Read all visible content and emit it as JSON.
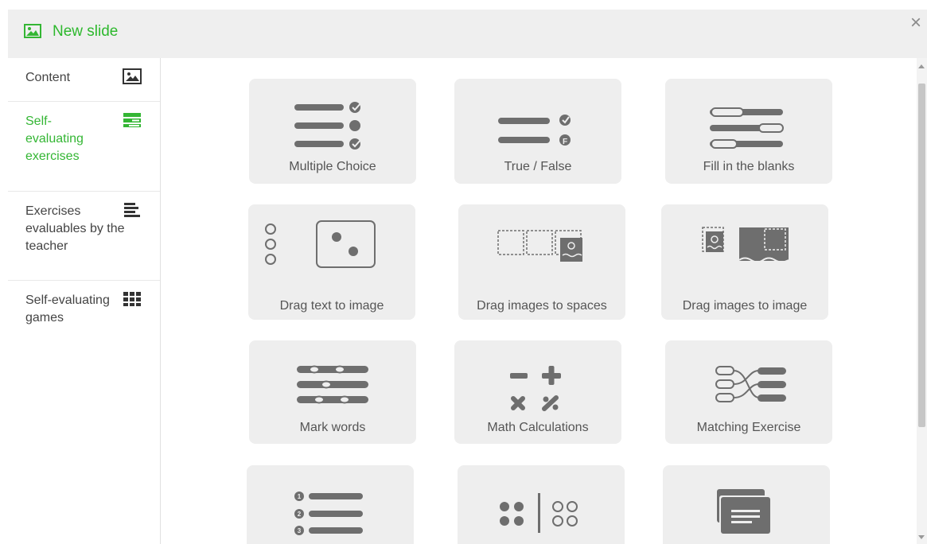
{
  "header": {
    "title": "New slide",
    "close_glyph": "×",
    "icon": "image-icon"
  },
  "sidebar": {
    "items": [
      {
        "label": "Content",
        "icon": "image-icon",
        "active": false
      },
      {
        "label": "Self-evaluating exercises",
        "icon": "stacked-bars-icon",
        "active": true
      },
      {
        "label": "Exercises evaluables by the teacher",
        "icon": "text-lines-icon",
        "active": false
      },
      {
        "label": "Self-evaluating games",
        "icon": "grid-icon",
        "active": false
      }
    ]
  },
  "tiles": [
    {
      "label": "Multiple Choice",
      "icon": "multiple-choice-icon"
    },
    {
      "label": "True / False",
      "icon": "true-false-icon"
    },
    {
      "label": "Fill in the blanks",
      "icon": "fill-blanks-icon"
    },
    {
      "label": "Drag text to image",
      "icon": "drag-text-to-image-icon"
    },
    {
      "label": "Drag images to spaces",
      "icon": "drag-images-to-spaces-icon"
    },
    {
      "label": "Drag images to image",
      "icon": "drag-images-to-image-icon"
    },
    {
      "label": "Mark words",
      "icon": "mark-words-icon"
    },
    {
      "label": "Math Calculations",
      "icon": "math-calculations-icon"
    },
    {
      "label": "Matching Exercise",
      "icon": "matching-exercise-icon"
    },
    {
      "label": "",
      "icon": "ordered-list-icon"
    },
    {
      "label": "",
      "icon": "classify-dots-icon"
    },
    {
      "label": "",
      "icon": "cards-icon"
    }
  ],
  "colors": {
    "accent": "#34b634",
    "icon_gray": "#6e6e6e",
    "tile_bg": "#eeeeee",
    "header_bg": "#efefef"
  }
}
